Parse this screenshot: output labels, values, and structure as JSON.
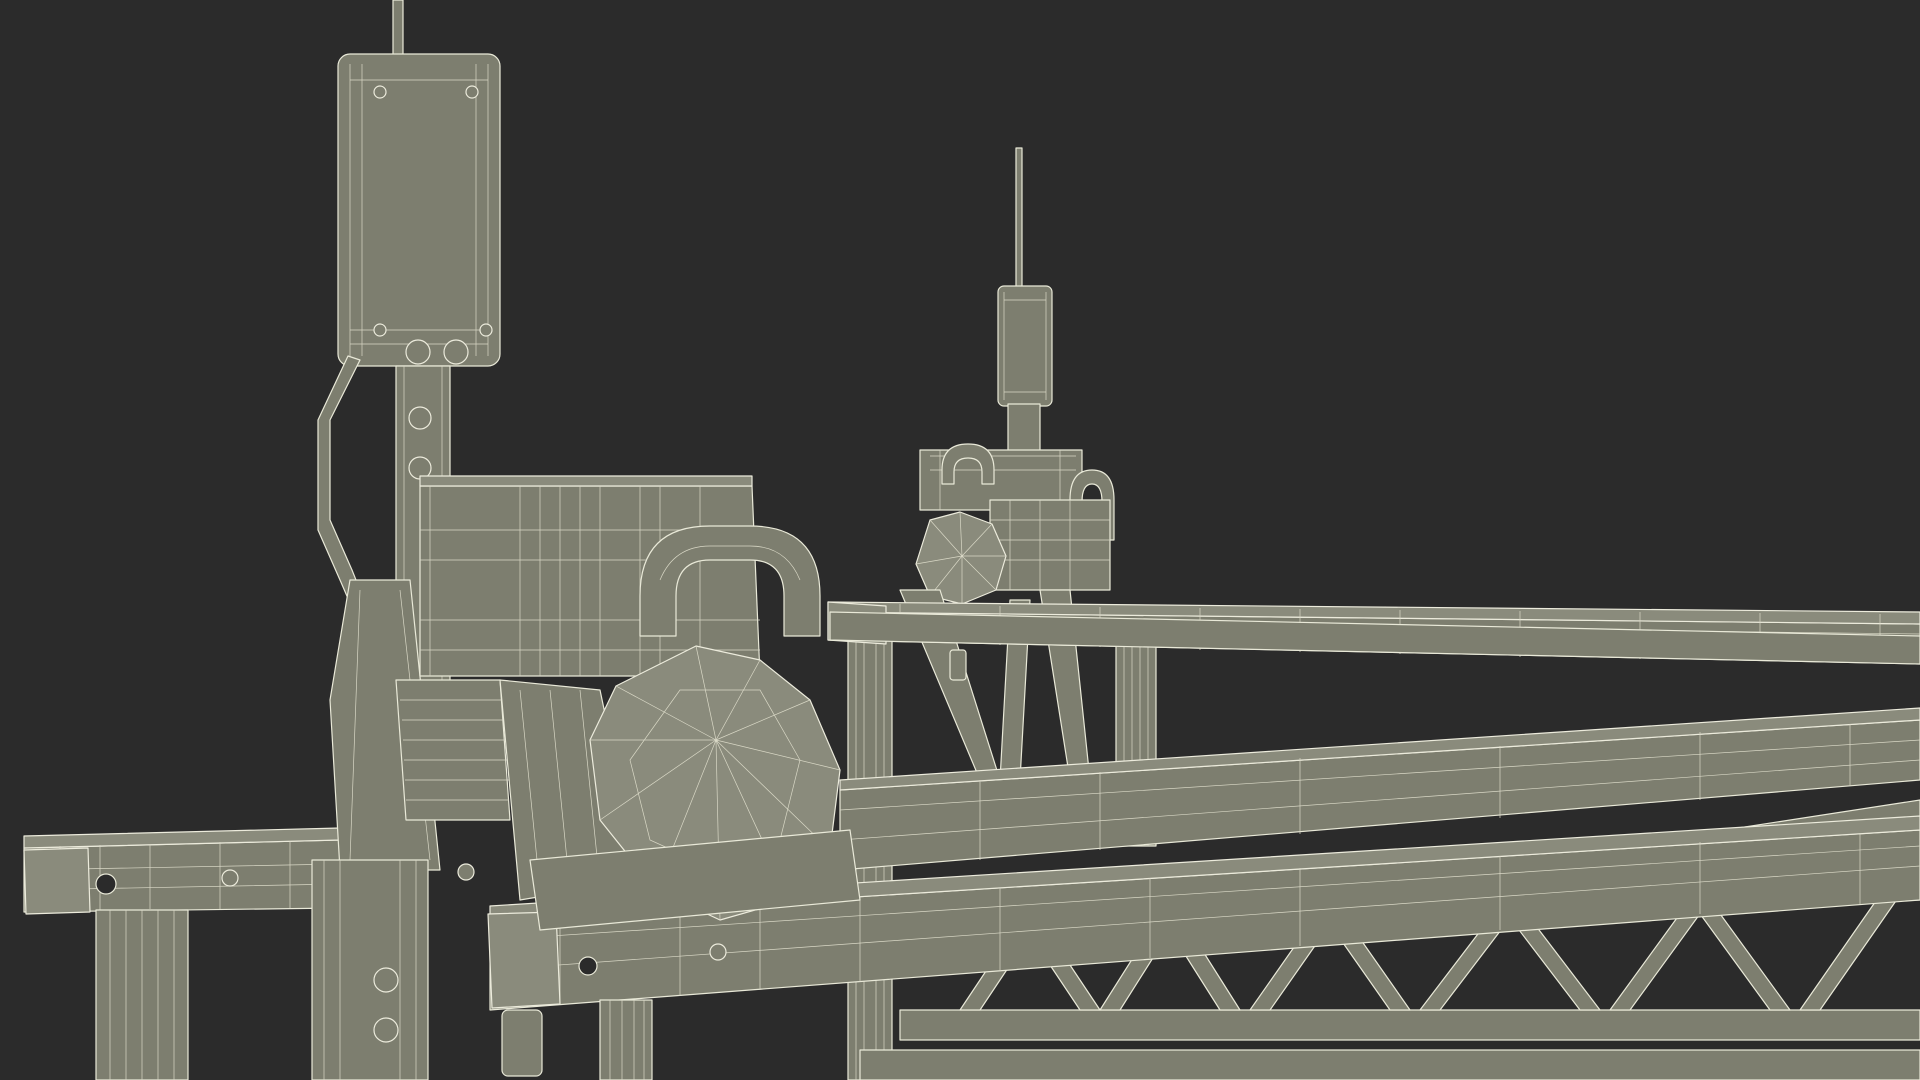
{
  "scene": {
    "background_color": "#2b2b2b",
    "model_fill_color": "#7d7e6f",
    "wireframe_color": "#e9e9d8"
  }
}
